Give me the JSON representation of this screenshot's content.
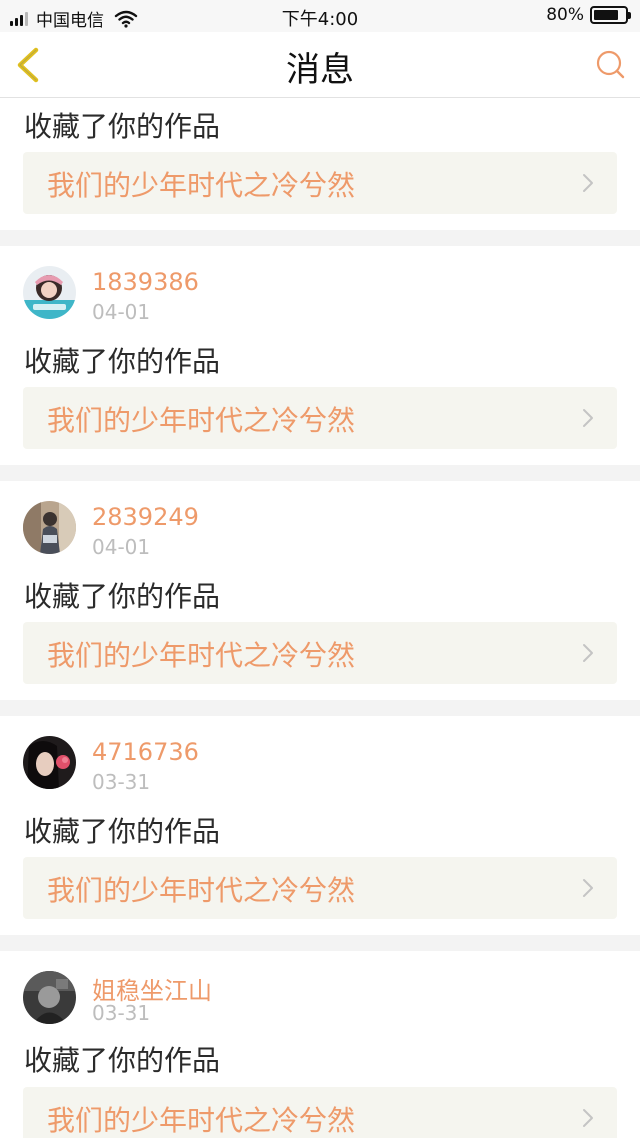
{
  "status_bar": {
    "carrier": "中国电信",
    "time": "下午4:00",
    "battery_text": "80%",
    "battery_level": 0.8,
    "signal_bars": 3
  },
  "nav": {
    "title": "消息",
    "back_icon": "chevron-left-icon",
    "search_icon": "search-icon",
    "accent_color": "#ee9a6a",
    "back_color": "#e0c020"
  },
  "messages": [
    {
      "action": "收藏了你的作品",
      "work_title": "我们的少年时代之冷兮然"
    },
    {
      "username": "1839386",
      "date": "04-01",
      "action": "收藏了你的作品",
      "work_title": "我们的少年时代之冷兮然"
    },
    {
      "username": "2839249",
      "date": "04-01",
      "action": "收藏了你的作品",
      "work_title": "我们的少年时代之冷兮然"
    },
    {
      "username": "4716736",
      "date": "03-31",
      "action": "收藏了你的作品",
      "work_title": "我们的少年时代之冷兮然"
    },
    {
      "username": "姐稳坐江山",
      "date": "03-31",
      "action": "收藏了你的作品",
      "work_title": "我们的少年时代之冷兮然"
    }
  ]
}
